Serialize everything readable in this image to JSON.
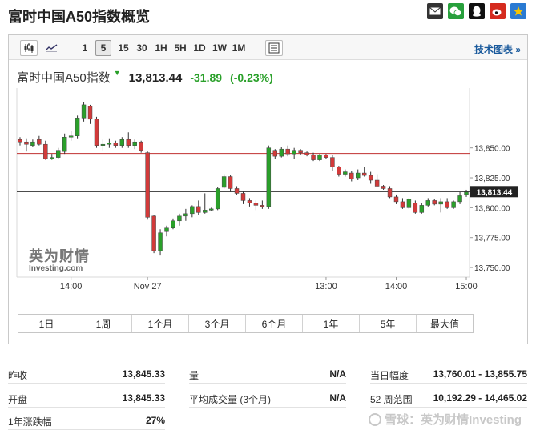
{
  "page": {
    "title": "富时中国A50指数概览",
    "share_icons": [
      "mail-icon",
      "wechat-icon",
      "qq-icon",
      "weibo-icon",
      "qzone-icon"
    ]
  },
  "toolbar": {
    "intervals": [
      "1",
      "5",
      "15",
      "30",
      "1H",
      "5H",
      "1D",
      "1W",
      "1M"
    ],
    "active_interval": "5",
    "tech_chart_label": "技术图表",
    "tech_chart_arrow": "»"
  },
  "quote": {
    "name": "富时中国A50指数",
    "arrow": "▼",
    "price": "13,813.44",
    "change": "-31.89",
    "change_pct": "(-0.23%)"
  },
  "watermark": {
    "cn": "英为财情",
    "en": "Investing.com"
  },
  "range_buttons": [
    "1日",
    "1周",
    "1个月",
    "3个月",
    "6个月",
    "1年",
    "5年",
    "最大值"
  ],
  "stats": [
    {
      "label": "昨收",
      "value": "13,845.33"
    },
    {
      "label": "量",
      "value": "N/A"
    },
    {
      "label": "当日幅度",
      "value": "13,760.01 - 13,855.75"
    },
    {
      "label": "开盘",
      "value": "13,845.33"
    },
    {
      "label": "平均成交量 (3个月)",
      "value": "N/A"
    },
    {
      "label": "52 周范围",
      "value": "10,192.29 - 14,465.02"
    },
    {
      "label": "1年涨跌幅",
      "value": "27%"
    }
  ],
  "footer": {
    "text": "雪球：英为财情Investing"
  },
  "colors": {
    "up": "#2aa02a",
    "down": "#d23a3a",
    "wick": "#333333",
    "prev_close_line": "#c03030",
    "last_price_line": "#111111",
    "last_price_bg": "#222222",
    "accent_link": "#1a5a9c"
  },
  "chart_data": {
    "type": "candlestick",
    "x_tick_labels": [
      "14:00",
      "Nov 27",
      "13:00",
      "14:00",
      "15:00"
    ],
    "x_tick_index": [
      8,
      20,
      48,
      59,
      70
    ],
    "y_ticks": [
      13750,
      13775,
      13800,
      13825,
      13850
    ],
    "y_tick_labels": [
      "13,750.00",
      "13,775.00",
      "13,800.00",
      "13,825.00",
      "13,850.00"
    ],
    "ylim": [
      13742,
      13900
    ],
    "prev_close": 13845.33,
    "prev_close_label": "",
    "last_price": 13813.44,
    "last_price_label": "13,813.44",
    "grid": false,
    "candles": [
      {
        "o": 13857,
        "h": 13859,
        "l": 13852,
        "c": 13855
      },
      {
        "o": 13855,
        "h": 13858,
        "l": 13847,
        "c": 13853
      },
      {
        "o": 13852,
        "h": 13857,
        "l": 13851,
        "c": 13855
      },
      {
        "o": 13857,
        "h": 13860,
        "l": 13852,
        "c": 13853
      },
      {
        "o": 13853,
        "h": 13856,
        "l": 13840,
        "c": 13841
      },
      {
        "o": 13841,
        "h": 13845,
        "l": 13840,
        "c": 13842
      },
      {
        "o": 13842,
        "h": 13850,
        "l": 13841,
        "c": 13848
      },
      {
        "o": 13847,
        "h": 13862,
        "l": 13845,
        "c": 13859
      },
      {
        "o": 13859,
        "h": 13864,
        "l": 13856,
        "c": 13860
      },
      {
        "o": 13860,
        "h": 13877,
        "l": 13858,
        "c": 13875
      },
      {
        "o": 13875,
        "h": 13888,
        "l": 13872,
        "c": 13886
      },
      {
        "o": 13885,
        "h": 13886,
        "l": 13870,
        "c": 13874
      },
      {
        "o": 13874,
        "h": 13876,
        "l": 13850,
        "c": 13852
      },
      {
        "o": 13852,
        "h": 13857,
        "l": 13848,
        "c": 13853
      },
      {
        "o": 13853,
        "h": 13858,
        "l": 13850,
        "c": 13854
      },
      {
        "o": 13854,
        "h": 13856,
        "l": 13850,
        "c": 13852
      },
      {
        "o": 13852,
        "h": 13859,
        "l": 13850,
        "c": 13857
      },
      {
        "o": 13857,
        "h": 13863,
        "l": 13850,
        "c": 13852
      },
      {
        "o": 13852,
        "h": 13857,
        "l": 13849,
        "c": 13855
      },
      {
        "o": 13855,
        "h": 13856,
        "l": 13846,
        "c": 13848
      },
      {
        "o": 13846,
        "h": 13847,
        "l": 13790,
        "c": 13792
      },
      {
        "o": 13793,
        "h": 13794,
        "l": 13762,
        "c": 13764
      },
      {
        "o": 13764,
        "h": 13782,
        "l": 13760,
        "c": 13779
      },
      {
        "o": 13780,
        "h": 13785,
        "l": 13776,
        "c": 13783
      },
      {
        "o": 13783,
        "h": 13791,
        "l": 13782,
        "c": 13789
      },
      {
        "o": 13789,
        "h": 13795,
        "l": 13785,
        "c": 13793
      },
      {
        "o": 13793,
        "h": 13799,
        "l": 13789,
        "c": 13795
      },
      {
        "o": 13795,
        "h": 13802,
        "l": 13792,
        "c": 13801
      },
      {
        "o": 13801,
        "h": 13806,
        "l": 13794,
        "c": 13796
      },
      {
        "o": 13796,
        "h": 13812,
        "l": 13795,
        "c": 13798
      },
      {
        "o": 13798,
        "h": 13800,
        "l": 13797,
        "c": 13799
      },
      {
        "o": 13799,
        "h": 13817,
        "l": 13798,
        "c": 13816
      },
      {
        "o": 13817,
        "h": 13828,
        "l": 13816,
        "c": 13826
      },
      {
        "o": 13826,
        "h": 13827,
        "l": 13813,
        "c": 13816
      },
      {
        "o": 13816,
        "h": 13818,
        "l": 13811,
        "c": 13812
      },
      {
        "o": 13812,
        "h": 13814,
        "l": 13803,
        "c": 13806
      },
      {
        "o": 13806,
        "h": 13808,
        "l": 13801,
        "c": 13804
      },
      {
        "o": 13804,
        "h": 13806,
        "l": 13798,
        "c": 13802
      },
      {
        "o": 13802,
        "h": 13806,
        "l": 13799,
        "c": 13801
      },
      {
        "o": 13801,
        "h": 13852,
        "l": 13799,
        "c": 13850
      },
      {
        "o": 13848,
        "h": 13849,
        "l": 13841,
        "c": 13843
      },
      {
        "o": 13843,
        "h": 13851,
        "l": 13842,
        "c": 13849
      },
      {
        "o": 13849,
        "h": 13852,
        "l": 13843,
        "c": 13845
      },
      {
        "o": 13845,
        "h": 13850,
        "l": 13841,
        "c": 13848
      },
      {
        "o": 13848,
        "h": 13849,
        "l": 13844,
        "c": 13846
      },
      {
        "o": 13846,
        "h": 13847,
        "l": 13843,
        "c": 13844
      },
      {
        "o": 13844,
        "h": 13846,
        "l": 13839,
        "c": 13840
      },
      {
        "o": 13840,
        "h": 13845,
        "l": 13839,
        "c": 13844
      },
      {
        "o": 13844,
        "h": 13845,
        "l": 13841,
        "c": 13842
      },
      {
        "o": 13842,
        "h": 13844,
        "l": 13831,
        "c": 13834
      },
      {
        "o": 13834,
        "h": 13835,
        "l": 13826,
        "c": 13828
      },
      {
        "o": 13828,
        "h": 13832,
        "l": 13826,
        "c": 13830
      },
      {
        "o": 13829,
        "h": 13831,
        "l": 13822,
        "c": 13824
      },
      {
        "o": 13825,
        "h": 13832,
        "l": 13823,
        "c": 13829
      },
      {
        "o": 13829,
        "h": 13834,
        "l": 13826,
        "c": 13827
      },
      {
        "o": 13827,
        "h": 13830,
        "l": 13820,
        "c": 13823
      },
      {
        "o": 13823,
        "h": 13828,
        "l": 13817,
        "c": 13818
      },
      {
        "o": 13818,
        "h": 13819,
        "l": 13815,
        "c": 13816
      },
      {
        "o": 13816,
        "h": 13818,
        "l": 13808,
        "c": 13809
      },
      {
        "o": 13809,
        "h": 13811,
        "l": 13803,
        "c": 13805
      },
      {
        "o": 13805,
        "h": 13808,
        "l": 13799,
        "c": 13800
      },
      {
        "o": 13800,
        "h": 13808,
        "l": 13799,
        "c": 13807
      },
      {
        "o": 13804,
        "h": 13806,
        "l": 13795,
        "c": 13796
      },
      {
        "o": 13796,
        "h": 13804,
        "l": 13795,
        "c": 13802
      },
      {
        "o": 13802,
        "h": 13808,
        "l": 13801,
        "c": 13806
      },
      {
        "o": 13806,
        "h": 13807,
        "l": 13802,
        "c": 13803
      },
      {
        "o": 13803,
        "h": 13808,
        "l": 13796,
        "c": 13805
      },
      {
        "o": 13805,
        "h": 13808,
        "l": 13799,
        "c": 13800
      },
      {
        "o": 13800,
        "h": 13806,
        "l": 13799,
        "c": 13805
      },
      {
        "o": 13805,
        "h": 13813,
        "l": 13803,
        "c": 13810
      },
      {
        "o": 13811,
        "h": 13815,
        "l": 13809,
        "c": 13813
      }
    ]
  }
}
